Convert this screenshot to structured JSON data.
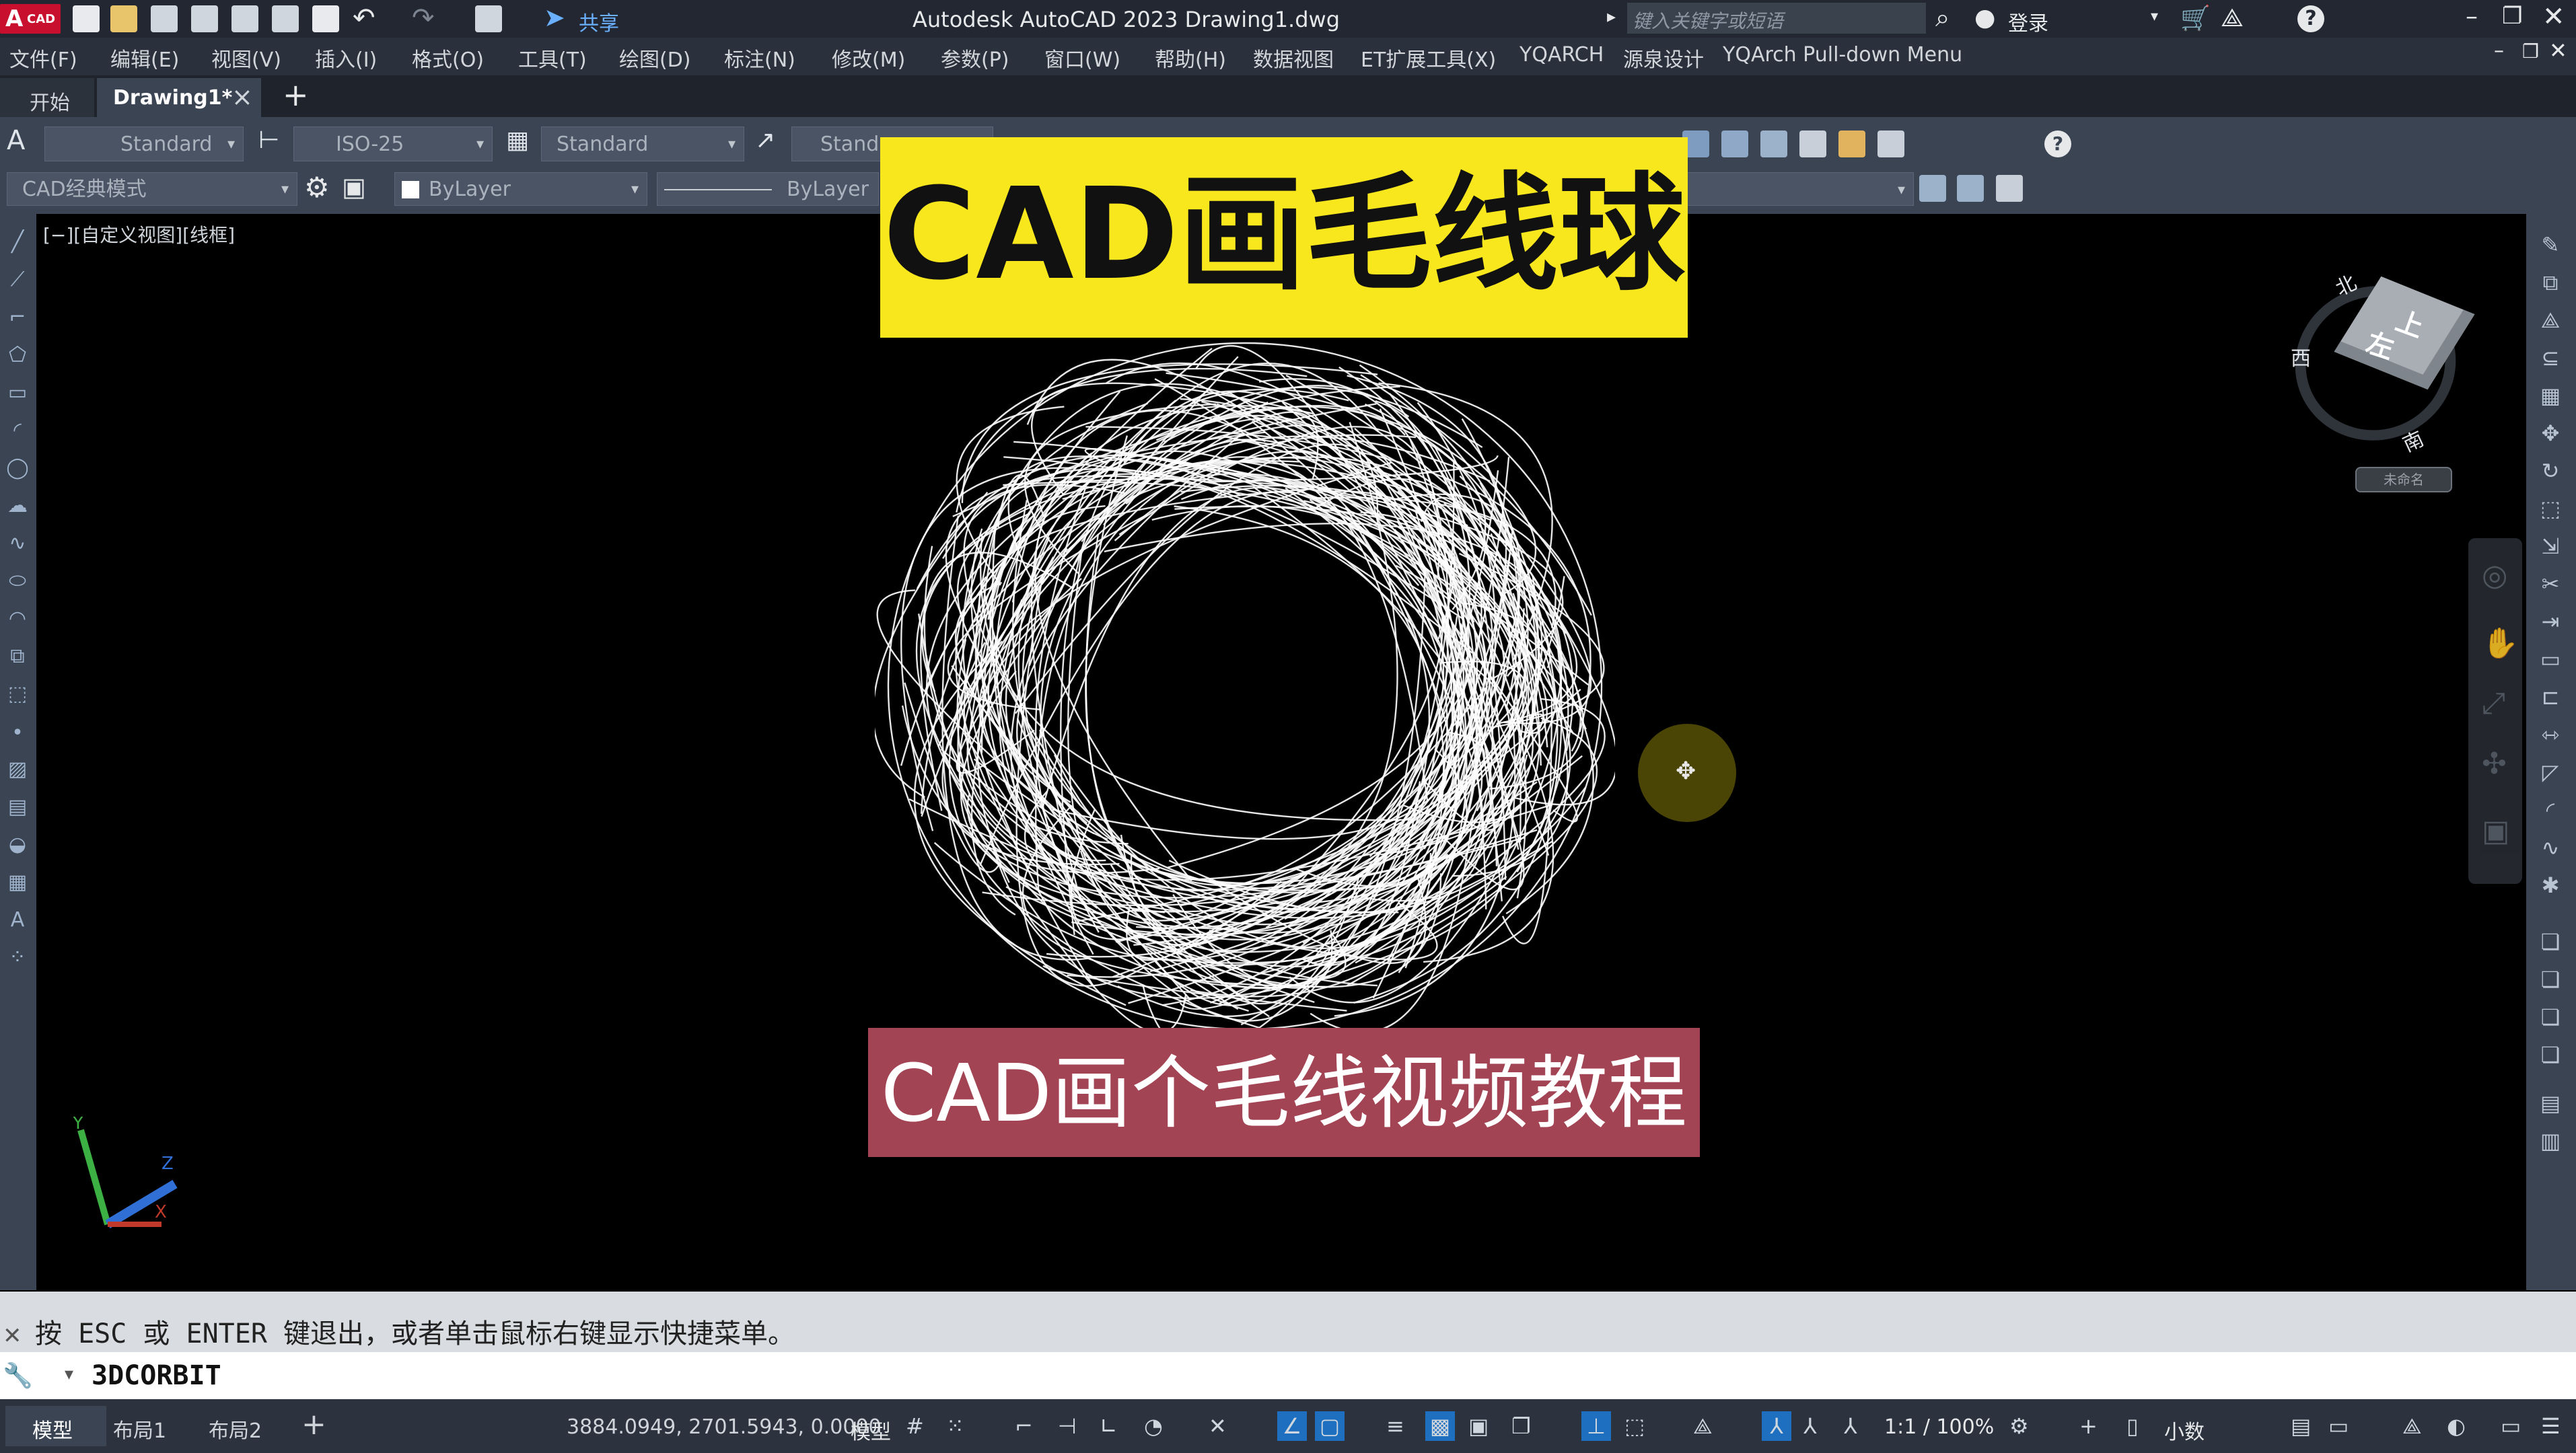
{
  "titlebar": {
    "app_badge": "A",
    "app_badge_sub": "CAD",
    "share_label": "共享",
    "title": "Autodesk AutoCAD 2023    Drawing1.dwg",
    "search_placeholder": "键入关键字或短语",
    "login_label": "登录",
    "help_icon": "?"
  },
  "menubar": {
    "items": [
      "文件(F)",
      "编辑(E)",
      "视图(V)",
      "插入(I)",
      "格式(O)",
      "工具(T)",
      "绘图(D)",
      "标注(N)",
      "修改(M)",
      "参数(P)",
      "窗口(W)",
      "帮助(H)",
      "数据视图",
      "ET扩展工具(X)",
      "YQARCH",
      "源泉设计",
      "YQArch Pull-down Menu"
    ]
  },
  "tabs": {
    "start_label": "开始",
    "drawing_label": "Drawing1*",
    "close_glyph": "×",
    "add_glyph": "+"
  },
  "toolbar1": {
    "text_style": "Standard",
    "dim_style": "ISO-25",
    "table_style": "Standard",
    "multileader_style": "Stand"
  },
  "toolbar2": {
    "workspace": "CAD经典模式",
    "layer": "ByLayer",
    "linetype": "ByLayer"
  },
  "viewport": {
    "label": "[−][自定义视图][线框]"
  },
  "overlay": {
    "main_title": "CAD画毛线球",
    "subtitle": "CAD画个毛线视频教程"
  },
  "viewcube": {
    "north": "北",
    "south": "南",
    "west": "西",
    "face_top": "上",
    "face_left": "左",
    "wcs_label": "未命名"
  },
  "ucs": {
    "x": "X",
    "y": "Y",
    "z": "Z"
  },
  "command": {
    "history": "按 ESC 或 ENTER 键退出，或者单击鼠标右键显示快捷菜单。",
    "current": "3DCORBIT"
  },
  "statusbar": {
    "model_tab": "模型",
    "layout1": "布局1",
    "layout2": "布局2",
    "coords": "3884.0949, 2701.5943, 0.0000",
    "model_label": "模型",
    "scale": "1:1 / 100%",
    "units": "小数"
  },
  "colors": {
    "title_bg": "#222731",
    "overlay_title_bg": "#f8e71c",
    "overlay_subtitle_bg": "#a34455",
    "viewport_bg": "#000000"
  }
}
